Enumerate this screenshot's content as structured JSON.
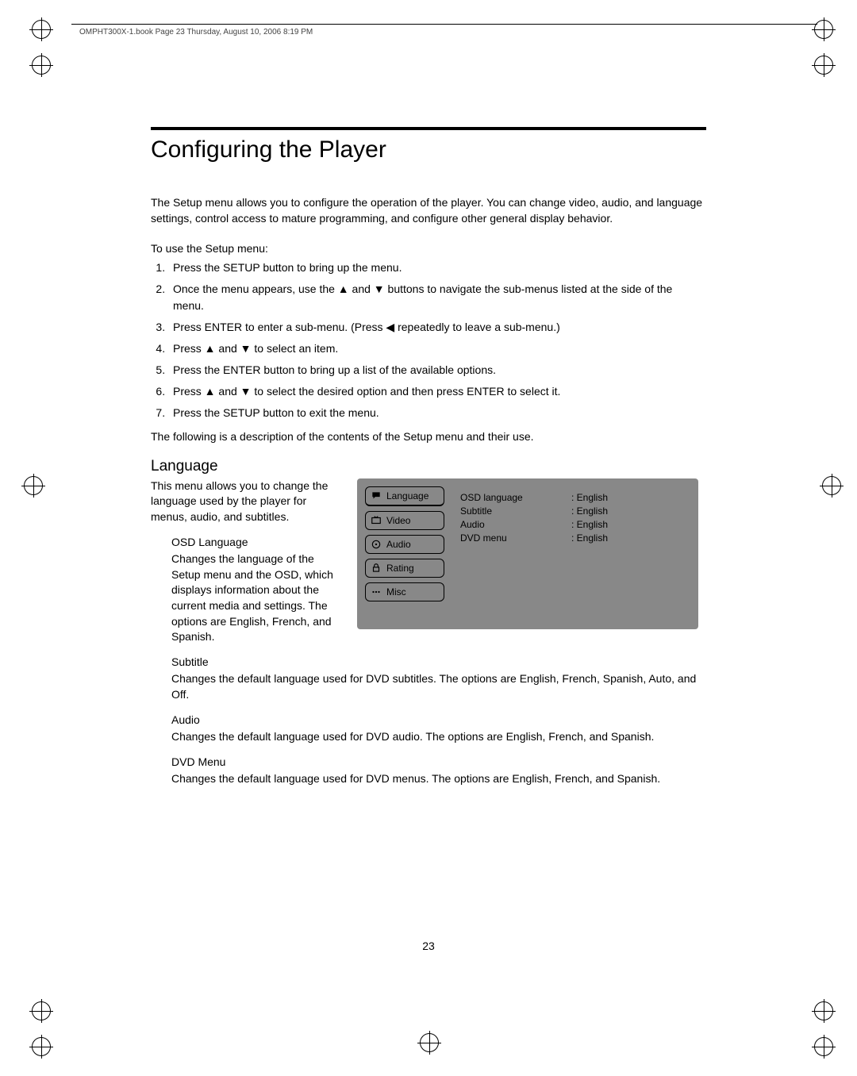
{
  "header": {
    "text": "OMPHT300X-1.book  Page 23  Thursday, August 10, 2006  8:19 PM"
  },
  "title": "Configuring the Player",
  "intro": "The Setup menu allows you to configure the operation of the player. You can change video, audio, and language settings, control access to mature programming, and configure other general display behavior.",
  "stepsHeading": "To use the Setup menu:",
  "steps": [
    "Press the SETUP button to bring up the menu.",
    "Once the menu appears, use the ▲ and ▼ buttons to navigate the sub-menus listed at the side of the menu.",
    "Press ENTER to enter a sub-menu. (Press ◀ repeatedly to leave a sub-menu.)",
    "Press ▲ and ▼ to select an item.",
    "Press the ENTER button to bring up a list of the available options.",
    "Press ▲ and ▼ to select the desired option and then press ENTER to select it.",
    "Press the SETUP button to exit the menu."
  ],
  "afterSteps": "The following is a description of the contents of the Setup menu and their use.",
  "language": {
    "heading": "Language",
    "intro": "This menu allows you to change the language used by the player for menus, audio, and subtitles.",
    "osdLang": {
      "heading": "OSD Language",
      "body": "Changes the language of the Setup menu and the OSD, which displays information about the current media and settings. The options are English, French, and Spanish."
    },
    "subtitle": {
      "heading": "Subtitle",
      "body": "Changes the default language used for DVD subtitles. The options are English, French, Spanish, Auto, and Off."
    },
    "audio": {
      "heading": "Audio",
      "body": "Changes the default language used for DVD audio. The options are English, French, and Spanish."
    },
    "dvdmenu": {
      "heading": "DVD Menu",
      "body": "Changes the default language used for DVD menus. The options are English, French, and Spanish."
    }
  },
  "osd": {
    "side": [
      "Language",
      "Video",
      "Audio",
      "Rating",
      "Misc"
    ],
    "rows": [
      {
        "k": "OSD language",
        "v": ": English"
      },
      {
        "k": "Subtitle",
        "v": ": English"
      },
      {
        "k": "Audio",
        "v": ": English"
      },
      {
        "k": "DVD menu",
        "v": ": English"
      }
    ]
  },
  "pageNumber": "23"
}
